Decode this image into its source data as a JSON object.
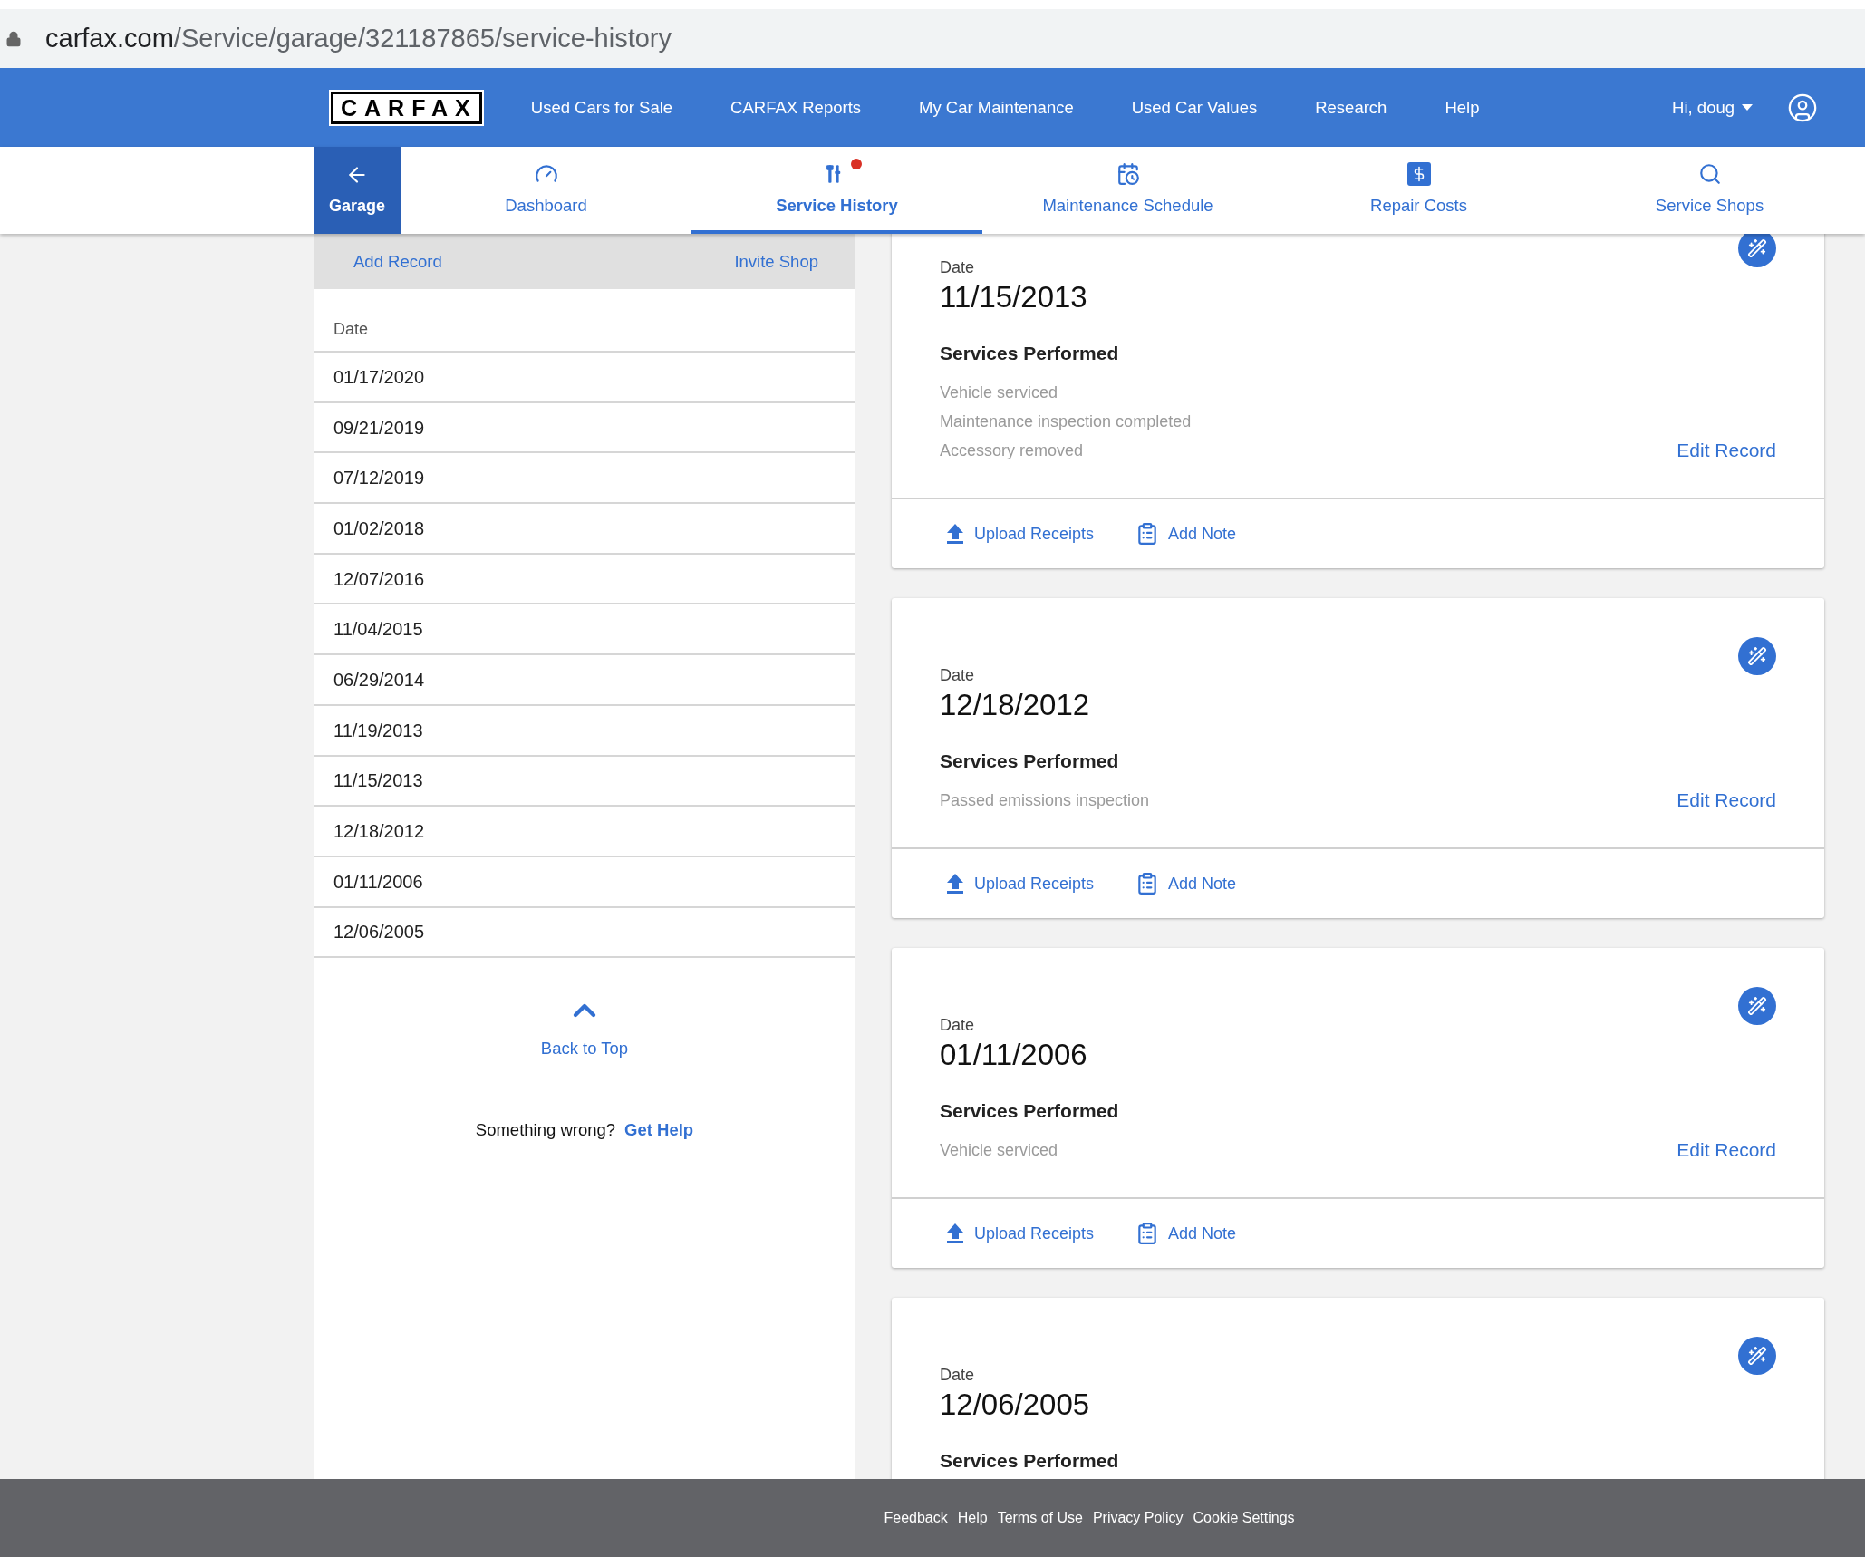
{
  "address_bar": {
    "host": "carfax.com",
    "path": "/Service/garage/321187865/service-history"
  },
  "top_nav": {
    "logo": "CARFAX",
    "links": [
      "Used Cars for Sale",
      "CARFAX Reports",
      "My Car Maintenance",
      "Used Car Values",
      "Research",
      "Help"
    ],
    "user": "Hi, doug"
  },
  "sub_nav": {
    "back": "Garage",
    "tabs": [
      {
        "label": "Dashboard",
        "selected": false,
        "alert": false
      },
      {
        "label": "Service History",
        "selected": true,
        "alert": true
      },
      {
        "label": "Maintenance Schedule",
        "selected": false,
        "alert": false
      },
      {
        "label": "Repair Costs",
        "selected": false,
        "alert": false
      },
      {
        "label": "Service Shops",
        "selected": false,
        "alert": false
      }
    ]
  },
  "sidebar": {
    "actions": [
      "Add Record",
      "Invite Shop"
    ],
    "column": "Date",
    "dates": [
      "01/17/2020",
      "09/21/2019",
      "07/12/2019",
      "01/02/2018",
      "12/07/2016",
      "11/04/2015",
      "06/29/2014",
      "11/19/2013",
      "11/15/2013",
      "12/18/2012",
      "01/11/2006",
      "12/06/2005"
    ],
    "back_to_top": "Back to Top",
    "help_text": "Something wrong?",
    "help_link": "Get Help"
  },
  "records": [
    {
      "date_label": "Date",
      "date": "11/15/2013",
      "services_title": "Services Performed",
      "services": [
        "Vehicle serviced",
        "Maintenance inspection completed",
        "Accessory removed"
      ],
      "edit": "Edit Record",
      "upload": "Upload Receipts",
      "note": "Add Note"
    },
    {
      "date_label": "Date",
      "date": "12/18/2012",
      "services_title": "Services Performed",
      "services": [
        "Passed emissions inspection"
      ],
      "edit": "Edit Record",
      "upload": "Upload Receipts",
      "note": "Add Note"
    },
    {
      "date_label": "Date",
      "date": "01/11/2006",
      "services_title": "Services Performed",
      "services": [
        "Vehicle serviced"
      ],
      "edit": "Edit Record",
      "upload": "Upload Receipts",
      "note": "Add Note"
    },
    {
      "date_label": "Date",
      "date": "12/06/2005",
      "services_title": "Services Performed"
    }
  ],
  "footer": [
    "Feedback",
    "Help",
    "Terms of Use",
    "Privacy Policy",
    "Cookie Settings"
  ]
}
